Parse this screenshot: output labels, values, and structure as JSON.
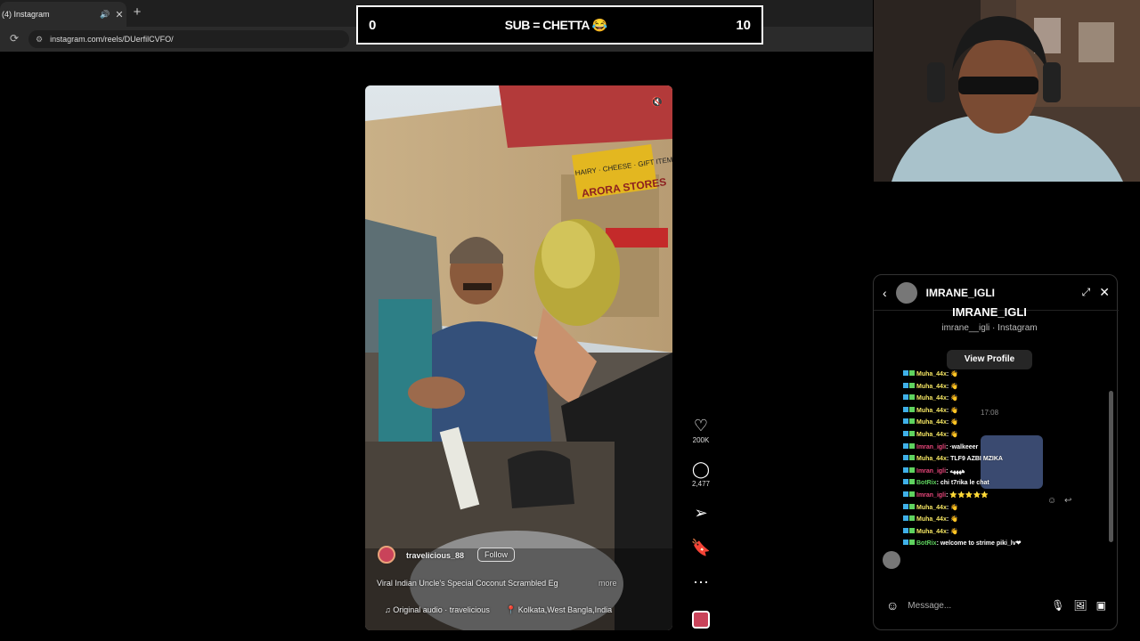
{
  "browser": {
    "tab_title": "(4) Instagram",
    "url": "instagram.com/reels/DUerfilCVFO/"
  },
  "scoreboard": {
    "left": "0",
    "title": "SUB = CHETTA 😂",
    "right": "10"
  },
  "reel": {
    "likes": "200K",
    "comments": "2,477",
    "username": "travelicious_88",
    "follow_label": "Follow",
    "caption": "Viral Indian Uncle's Special Coconut Scrambled Eg",
    "more_label": "more",
    "audio": "Original audio · travelicious",
    "location": "Kolkata,West Bangla,India",
    "shop_sign": "ARORA STORES",
    "shop_sign_top": "HAIRY · CHEESE · GIFT ITEMS"
  },
  "chat": {
    "name": "IMRANE_IGLI",
    "profile_name": "IMRANE_IGLI",
    "profile_sub": "imrane__igli · Instagram",
    "view_profile": "View Profile",
    "time": "17:08",
    "placeholder": "Message..."
  },
  "stream_chat": [
    {
      "user": "Muha_44x",
      "text": ": 👋",
      "color": "#f5e663"
    },
    {
      "user": "Muha_44x",
      "text": ": 👋",
      "color": "#f5e663"
    },
    {
      "user": "Muha_44x",
      "text": ": 👋",
      "color": "#f5e663"
    },
    {
      "user": "Muha_44x",
      "text": ": 👋",
      "color": "#f5e663"
    },
    {
      "user": "Muha_44x",
      "text": ": 👋",
      "color": "#f5e663"
    },
    {
      "user": "Muha_44x",
      "text": ": 👋",
      "color": "#f5e663"
    },
    {
      "user": "Imran_igli",
      "text": ": ·walkeeer",
      "color": "#e8467a"
    },
    {
      "user": "Muha_44x",
      "text": ": TLF9 AZBI MZIKA",
      "color": "#f5e663"
    },
    {
      "user": "Imran_igli",
      "text": ": ههههه",
      "color": "#e8467a"
    },
    {
      "user": "BotRix",
      "text": ": chi t7rika le chat",
      "color": "#5fd35f"
    },
    {
      "user": "Imran_igli",
      "text": ": ⭐⭐⭐⭐⭐",
      "color": "#e8467a"
    },
    {
      "user": "Muha_44x",
      "text": ": 👋",
      "color": "#f5e663"
    },
    {
      "user": "Muha_44x",
      "text": ": 👋",
      "color": "#f5e663"
    },
    {
      "user": "Muha_44x",
      "text": ": 👋",
      "color": "#f5e663"
    },
    {
      "user": "BotRix",
      "text": ": welcome to strime piki_lv❤",
      "color": "#5fd35f"
    }
  ]
}
